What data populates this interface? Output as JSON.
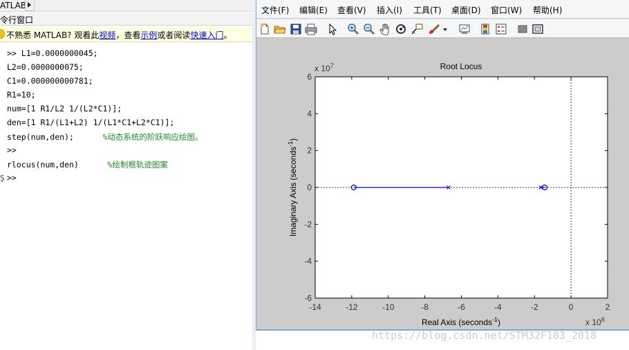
{
  "left_panel": {
    "breadcrumb": "ATLAB",
    "title": "令行窗口",
    "infobar": {
      "text_1": "不熟悉 MATLAB? 观看此",
      "link_1": "视频",
      "text_2": "，查看",
      "link_2": "示例",
      "text_3": "或者阅读",
      "link_3": "快速入门",
      "text_4": "。"
    },
    "console_lines": [
      {
        "code": ">> L1=0.0000000045;",
        "comment": ""
      },
      {
        "code": "L2=0.0000000075;",
        "comment": ""
      },
      {
        "code": "C1=0.000000000781;",
        "comment": ""
      },
      {
        "code": "R1=10;",
        "comment": ""
      },
      {
        "code": "num=[1 R1/L2 1/(L2*C1)];",
        "comment": ""
      },
      {
        "code": "den=[1 R1/(L1+L2) 1/(L1*C1+L2*C1)];",
        "comment": ""
      },
      {
        "code": "step(num,den);      ",
        "comment": "%动态系统的阶跃响应绘图。"
      },
      {
        "code": ">>",
        "comment": ""
      },
      {
        "code": "rlocus(num,den)      ",
        "comment": "%绘制根轨迹图案"
      },
      {
        "code": ">>",
        "comment": ""
      }
    ],
    "cursor_mark": "Ş"
  },
  "figure": {
    "menu": [
      "文件(F)",
      "编辑(E)",
      "查看(V)",
      "插入(I)",
      "工具(T)",
      "桌面(D)",
      "窗口(W)",
      "帮助(H)"
    ],
    "toolbar_icons": [
      "new-figure-icon",
      "open-file-icon",
      "save-icon",
      "print-icon",
      "select-arrow-icon",
      "zoom-in-icon",
      "zoom-out-icon",
      "pan-hand-icon",
      "rotate-3d-icon",
      "data-cursor-icon",
      "brush-icon",
      "brush-dropdown-icon",
      "link-plot-icon",
      "colorbar-icon",
      "legend-icon",
      "hide-plot-tools-icon",
      "show-plot-tools-icon"
    ]
  },
  "chart_data": {
    "type": "scatter",
    "title": "Root Locus",
    "xlabel": "Real Axis (seconds",
    "xlabel_sup": "-1",
    "xlabel_end": ")",
    "ylabel": "Imaginary Axis (seconds",
    "ylabel_sup": "-1",
    "ylabel_end": ")",
    "x_multiplier": "x 10",
    "x_multiplier_exp": "8",
    "y_multiplier": "x 10",
    "y_multiplier_exp": "7",
    "xlim": [
      -14,
      2
    ],
    "ylim": [
      -6,
      6
    ],
    "xticks": [
      -14,
      -12,
      -10,
      -8,
      -6,
      -4,
      -2,
      0,
      2
    ],
    "yticks": [
      -6,
      -4,
      -2,
      0,
      2,
      4,
      6
    ],
    "zeros": [
      [
        -11.89,
        0
      ],
      [
        -1.44,
        0
      ]
    ],
    "poles": [
      [
        -6.7,
        0
      ],
      [
        -1.65,
        0
      ]
    ],
    "locus_segments": [
      {
        "from": [
          -6.7,
          0
        ],
        "to": [
          -11.89,
          0
        ]
      },
      {
        "from": [
          -1.65,
          0
        ],
        "to": [
          -1.44,
          0
        ]
      }
    ],
    "grid": false,
    "line_color": "#0000ff",
    "reference_lines_color": "#000000"
  },
  "watermark": "https://blog.csdn.net/STM32F103_2018"
}
